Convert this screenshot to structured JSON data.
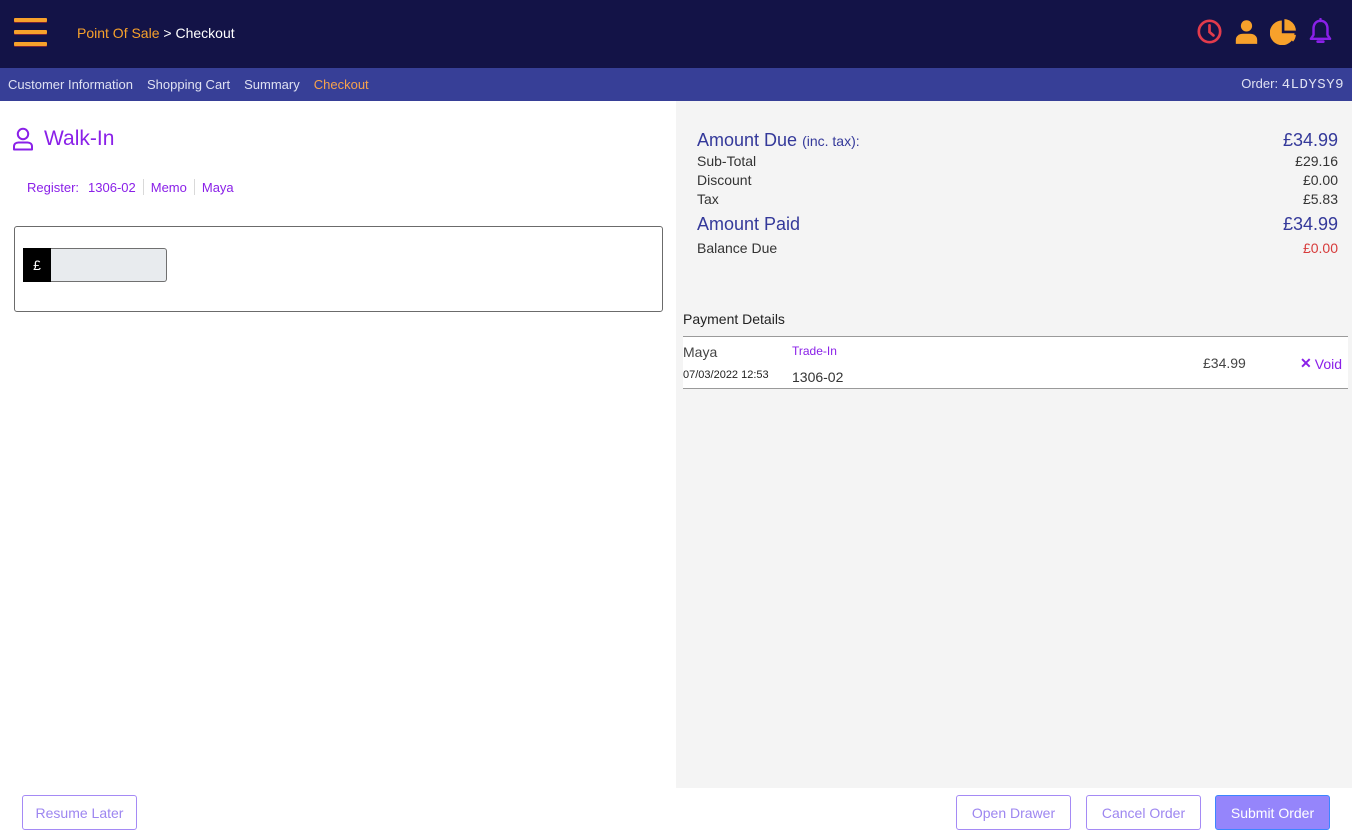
{
  "header": {
    "menu_icon": "hamburger-icon",
    "breadcrumb": {
      "parent": "Point Of Sale",
      "separator": " > ",
      "current": "Checkout"
    },
    "icons": [
      {
        "name": "clock-icon",
        "color": "#e23b4c"
      },
      {
        "name": "user-icon",
        "color": "#f7a12b"
      },
      {
        "name": "pie-chart-icon",
        "color": "#f7a12b"
      },
      {
        "name": "bell-icon",
        "color": "#8a20e8"
      }
    ]
  },
  "nav": {
    "tabs": [
      {
        "label": "Customer Information",
        "active": false
      },
      {
        "label": "Shopping Cart",
        "active": false
      },
      {
        "label": "Summary",
        "active": false
      },
      {
        "label": "Checkout",
        "active": true
      }
    ],
    "order_label": "Order:",
    "order_code": "4LDYSY9"
  },
  "customer": {
    "name": "Walk-In",
    "register_label": "Register:",
    "register": "1306-02",
    "memo_label": "Memo",
    "user": "Maya"
  },
  "tender": {
    "currency_symbol": "£",
    "amount_value": "",
    "amount_placeholder": ""
  },
  "totals": {
    "amount_due_label": "Amount Due",
    "amount_due_suffix": "(inc. tax):",
    "amount_due": "£34.99",
    "subtotal_label": "Sub-Total",
    "subtotal": "£29.16",
    "discount_label": "Discount",
    "discount": "£0.00",
    "tax_label": "Tax",
    "tax": "£5.83",
    "amount_paid_label": "Amount Paid",
    "amount_paid": "£34.99",
    "balance_due_label": "Balance Due",
    "balance_due": "£0.00"
  },
  "payments": {
    "title": "Payment Details",
    "rows": [
      {
        "user": "Maya",
        "datetime": "07/03/2022 12:53",
        "type": "Trade-In",
        "register": "1306-02",
        "amount": "£34.99",
        "void_label": "Void"
      }
    ]
  },
  "footer": {
    "resume_label": "Resume Later",
    "open_drawer_label": "Open Drawer",
    "cancel_label": "Cancel Order",
    "submit_label": "Submit Order"
  },
  "colors": {
    "topbar": "#131347",
    "navbar": "#373f97",
    "accent_orange": "#f7a12b",
    "accent_purple": "#8a20e8",
    "totals_blue": "#34399a",
    "negative_red": "#d73b3b",
    "submit_bg": "#9585fb"
  }
}
